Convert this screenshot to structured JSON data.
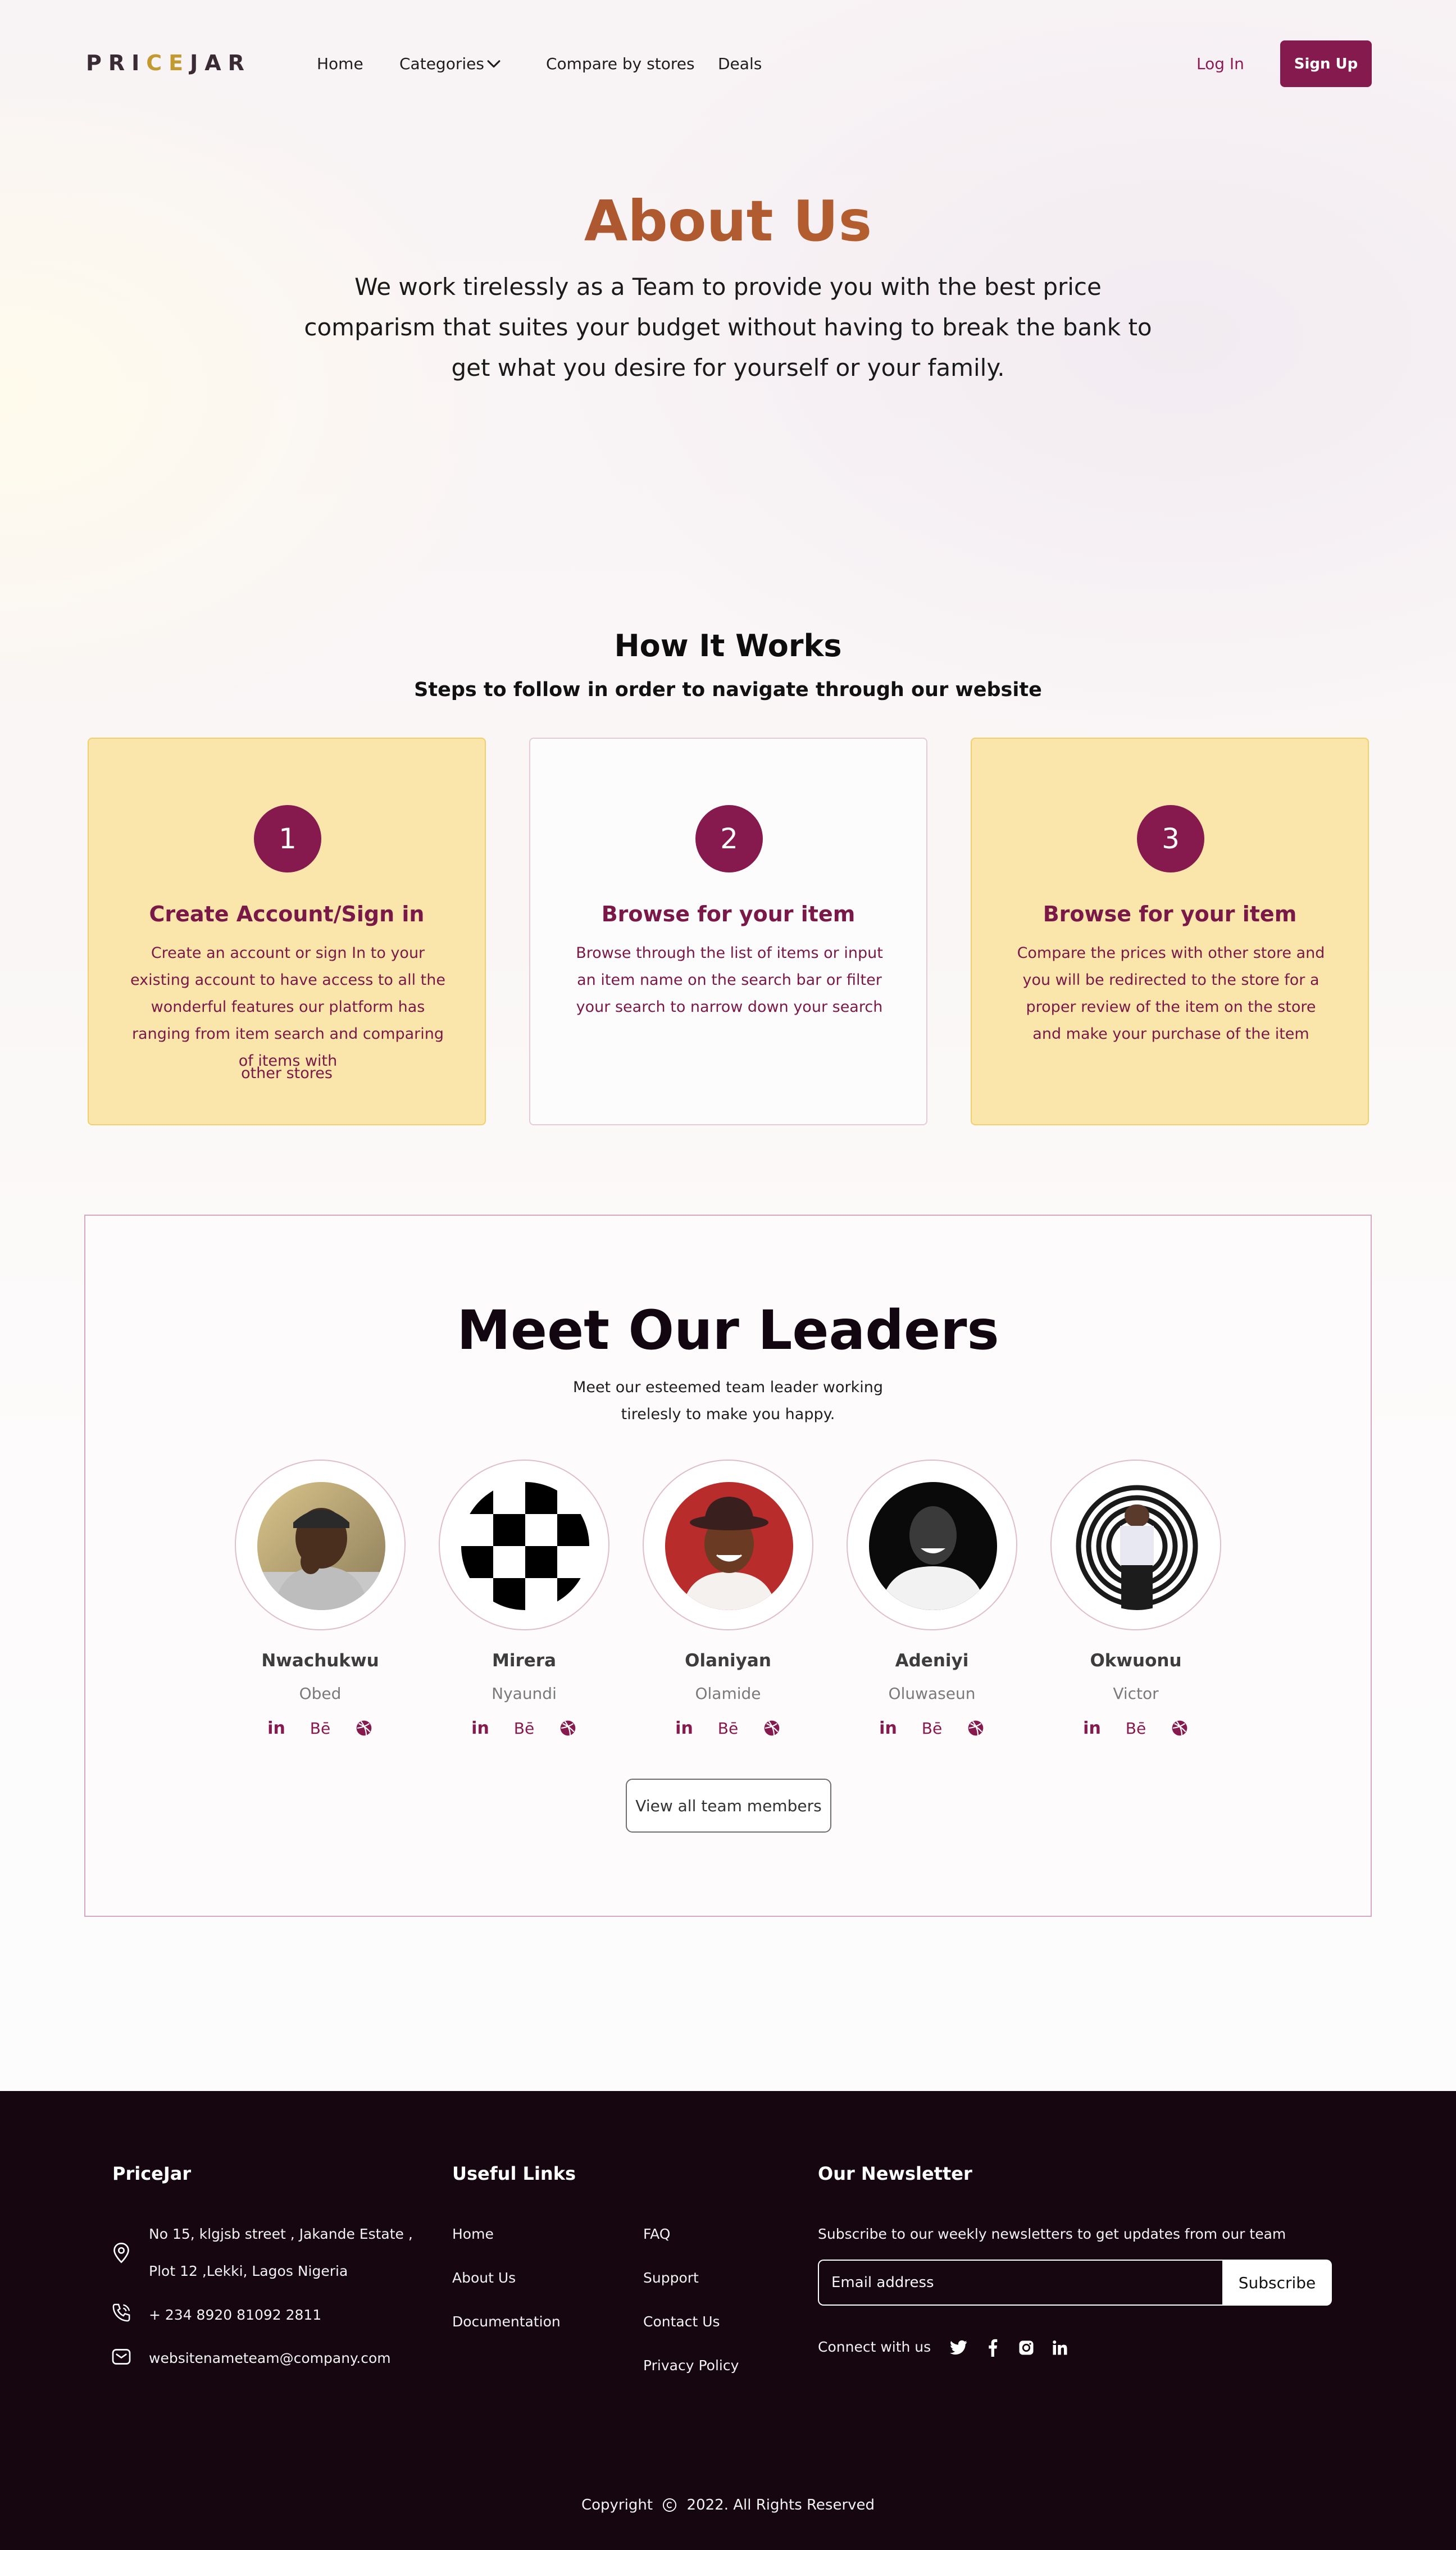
{
  "brand": {
    "logo_part1": "PRI",
    "logo_part2": "CE",
    "logo_part3": "JAR",
    "accent_color": "#861a4f",
    "gold_color": "#c39a2f"
  },
  "nav": {
    "home": "Home",
    "categories": "Categories",
    "compare": "Compare by stores",
    "deals": "Deals",
    "login": "Log In",
    "signup": "Sign Up"
  },
  "about": {
    "title": "About Us",
    "text": "We work tirelessly as a Team to provide you with the best price comparism that suites your budget without having to break the bank to get what you desire for yourself or your family."
  },
  "how": {
    "title": "How It Works",
    "subtitle": "Steps to follow in order to navigate through our website",
    "steps": [
      {
        "number": "1",
        "title": "Create Account/Sign in",
        "description": "Create an account or sign In to your existing account to have access to all the wonderful features our platform has ranging from item search and comparing of items with",
        "extra": "other stores"
      },
      {
        "number": "2",
        "title": "Browse for your item",
        "description": "Browse through the list of items or input an item name on the search bar or filter your search to narrow down your search"
      },
      {
        "number": "3",
        "title": "Browse for your item",
        "description": "Compare the prices with other store and you will be redirected to the store for a proper review of the item on the store and make your purchase of the item"
      }
    ]
  },
  "leaders": {
    "title": "Meet Our Leaders",
    "subtitle_line1": "Meet our esteemed team leader working",
    "subtitle_line2": "tirelesly to make you happy.",
    "members": [
      {
        "first": "Nwachukwu",
        "last": "Obed",
        "avatar": "photo-avatar"
      },
      {
        "first": "Mirera",
        "last": "Nyaundi",
        "avatar": "checker-avatar"
      },
      {
        "first": "Olaniyan",
        "last": "Olamide",
        "avatar": "photo-avatar"
      },
      {
        "first": "Adeniyi",
        "last": "Oluwaseun",
        "avatar": "photo-avatar"
      },
      {
        "first": "Okwuonu",
        "last": "Victor",
        "avatar": "photo-avatar"
      }
    ],
    "social_icons": [
      "linkedin-icon",
      "behance-icon",
      "dribbble-icon"
    ],
    "social_labels": {
      "linkedin": "in",
      "behance": "Bē"
    },
    "view_all": "View all team members"
  },
  "footer": {
    "brand": "PriceJar",
    "address_line1": "No 15, klgjsb street , Jakande Estate ,",
    "address_line2": "Plot 12 ,Lekki, Lagos Nigeria",
    "phone": "+ 234 8920 81092 2811",
    "email": "websitenameteam@company.com",
    "useful_links_title": "Useful Links",
    "links_col1": [
      "Home",
      "About Us",
      "Documentation"
    ],
    "links_col2": [
      "FAQ",
      "Support",
      "Contact Us",
      "Privacy Policy"
    ],
    "newsletter_title": "Our Newsletter",
    "newsletter_text": "Subscribe to our weekly newsletters to get updates from our team",
    "email_placeholder": "Email address",
    "subscribe": "Subscribe",
    "connect": "Connect with us",
    "connect_icons": [
      "twitter-icon",
      "facebook-icon",
      "instagram-icon",
      "linkedin-icon"
    ],
    "copyright_prefix": "Copyright",
    "copyright_suffix": "2022. All Rights Reserved"
  }
}
